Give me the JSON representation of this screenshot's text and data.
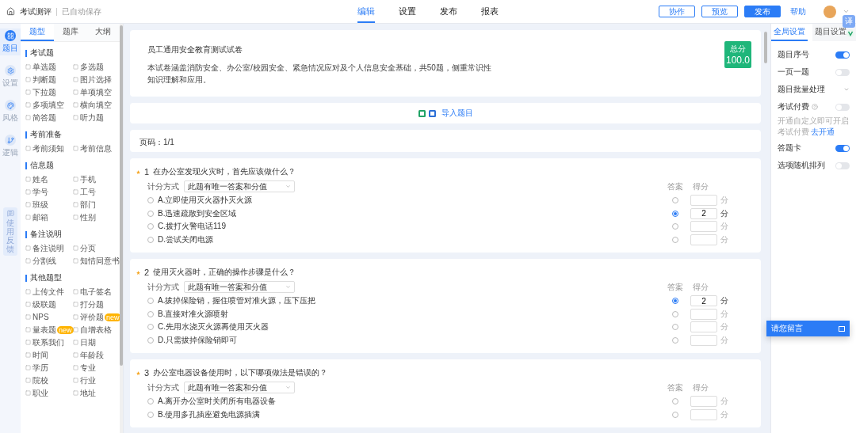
{
  "topbar": {
    "title": "考试测评",
    "save_status": "已自动保存",
    "tabs": [
      {
        "label": "编辑",
        "selected": true
      },
      {
        "label": "设置",
        "selected": false
      },
      {
        "label": "发布",
        "selected": false
      },
      {
        "label": "报表",
        "selected": false
      }
    ],
    "actions": [
      {
        "label": "协作",
        "kind": "outline"
      },
      {
        "label": "预览",
        "kind": "outline"
      },
      {
        "label": "发布",
        "kind": "primary"
      },
      {
        "label": "帮助",
        "kind": "link"
      }
    ]
  },
  "rail": [
    {
      "label": "题目",
      "selected": true
    },
    {
      "label": "设置",
      "selected": false
    },
    {
      "label": "风格",
      "selected": false
    },
    {
      "label": "逻辑",
      "selected": false
    }
  ],
  "feedback": "使用反馈",
  "palette": {
    "tabs": [
      {
        "label": "题型",
        "selected": true
      },
      {
        "label": "题库",
        "selected": false
      },
      {
        "label": "大纲",
        "selected": false
      }
    ],
    "sections": [
      {
        "title": "考试题",
        "items": [
          {
            "label": "单选题"
          },
          {
            "label": "多选题"
          },
          {
            "label": "判断题"
          },
          {
            "label": "图片选择"
          },
          {
            "label": "下拉题"
          },
          {
            "label": "单项填空"
          },
          {
            "label": "多项填空"
          },
          {
            "label": "横向填空"
          },
          {
            "label": "简答题"
          },
          {
            "label": "听力题"
          }
        ]
      },
      {
        "title": "考前准备",
        "items": [
          {
            "label": "考前须知"
          },
          {
            "label": "考前信息"
          }
        ]
      },
      {
        "title": "信息题",
        "items": [
          {
            "label": "姓名"
          },
          {
            "label": "手机"
          },
          {
            "label": "学号"
          },
          {
            "label": "工号"
          },
          {
            "label": "班级"
          },
          {
            "label": "部门"
          },
          {
            "label": "邮箱"
          },
          {
            "label": "性别"
          }
        ]
      },
      {
        "title": "备注说明",
        "items": [
          {
            "label": "备注说明"
          },
          {
            "label": "分页"
          },
          {
            "label": "分割线"
          },
          {
            "label": "知情同意书"
          }
        ]
      },
      {
        "title": "其他题型",
        "items": [
          {
            "label": "上传文件"
          },
          {
            "label": "电子签名"
          },
          {
            "label": "级联题"
          },
          {
            "label": "打分题"
          },
          {
            "label": "NPS"
          },
          {
            "label": "评价题",
            "badge": "new"
          },
          {
            "label": "量表题",
            "badge": "new"
          },
          {
            "label": "自增表格"
          },
          {
            "label": "联系我们"
          },
          {
            "label": "日期"
          },
          {
            "label": "时间"
          },
          {
            "label": "年龄段"
          },
          {
            "label": "学历"
          },
          {
            "label": "专业"
          },
          {
            "label": "院校"
          },
          {
            "label": "行业"
          },
          {
            "label": "职业"
          },
          {
            "label": "地址"
          }
        ]
      }
    ]
  },
  "paper": {
    "title": "员工通用安全教育测试试卷",
    "description": "本试卷涵盖消防安全、办公室/校园安全、紧急情况应对及个人信息安全基础，共50题，侧重常识性知识理解和应用。",
    "score_label": "总分",
    "score": "100.0"
  },
  "import_label": "导入题目",
  "page_indicator": "页码：1/1",
  "questions": [
    {
      "number": "1",
      "required": true,
      "title": "在办公室发现火灾时，首先应该做什么？",
      "scoring_label": "计分方式",
      "scoring_mode": "此题有唯一答案和分值",
      "answer_header": "答案",
      "score_header": "得分",
      "options": [
        {
          "text": "A.立即使用灭火器扑灭火源",
          "checked": false,
          "selected": false,
          "unit": "分"
        },
        {
          "text": "B.迅速疏散到安全区域",
          "checked": false,
          "selected": true,
          "score": "2",
          "unit": "分"
        },
        {
          "text": "C.拨打火警电话119",
          "checked": false,
          "selected": false,
          "unit": "分"
        },
        {
          "text": "D.尝试关闭电源",
          "checked": false,
          "selected": false,
          "unit": "分"
        }
      ]
    },
    {
      "number": "2",
      "required": true,
      "title": "使用灭火器时，正确的操作步骤是什么？",
      "scoring_label": "计分方式",
      "scoring_mode": "此题有唯一答案和分值",
      "answer_header": "答案",
      "score_header": "得分",
      "options": [
        {
          "text": "A.拔掉保险销，握住喷管对准火源，压下压把",
          "checked": false,
          "selected": true,
          "score": "2",
          "unit": "分"
        },
        {
          "text": "B.直接对准火源喷射",
          "checked": false,
          "selected": false,
          "unit": "分"
        },
        {
          "text": "C.先用水浇灭火源再使用灭火器",
          "checked": false,
          "selected": false,
          "unit": "分"
        },
        {
          "text": "D.只需拔掉保险销即可",
          "checked": false,
          "selected": false,
          "unit": "分"
        }
      ]
    },
    {
      "number": "3",
      "required": true,
      "title": "办公室电器设备使用时，以下哪项做法是错误的？",
      "scoring_label": "计分方式",
      "scoring_mode": "此题有唯一答案和分值",
      "answer_header": "答案",
      "score_header": "得分",
      "options": [
        {
          "text": "A.离开办公室时关闭所有电器设备",
          "checked": false,
          "selected": false,
          "unit": "分"
        },
        {
          "text": "B.使用多孔插座避免电源插满",
          "checked": false,
          "selected": false,
          "unit": "分"
        }
      ]
    }
  ],
  "settings": {
    "tabs": [
      {
        "label": "全局设置",
        "selected": true
      },
      {
        "label": "题目设置",
        "selected": false
      }
    ],
    "items": [
      {
        "kind": "toggle",
        "label": "题目序号",
        "on": true
      },
      {
        "kind": "toggle",
        "label": "一页一题",
        "on": false
      },
      {
        "kind": "expand",
        "label": "题目批量处理"
      },
      {
        "kind": "toggle",
        "label": "考试付费",
        "on": false,
        "help": true,
        "note": "开通自定义即可开启考试付费",
        "note_link": "去开通"
      },
      {
        "kind": "toggle",
        "label": "答题卡",
        "on": true
      },
      {
        "kind": "toggle",
        "label": "选项随机排列",
        "on": false
      }
    ]
  },
  "translate_badge": "译",
  "message_button": "请您留言"
}
